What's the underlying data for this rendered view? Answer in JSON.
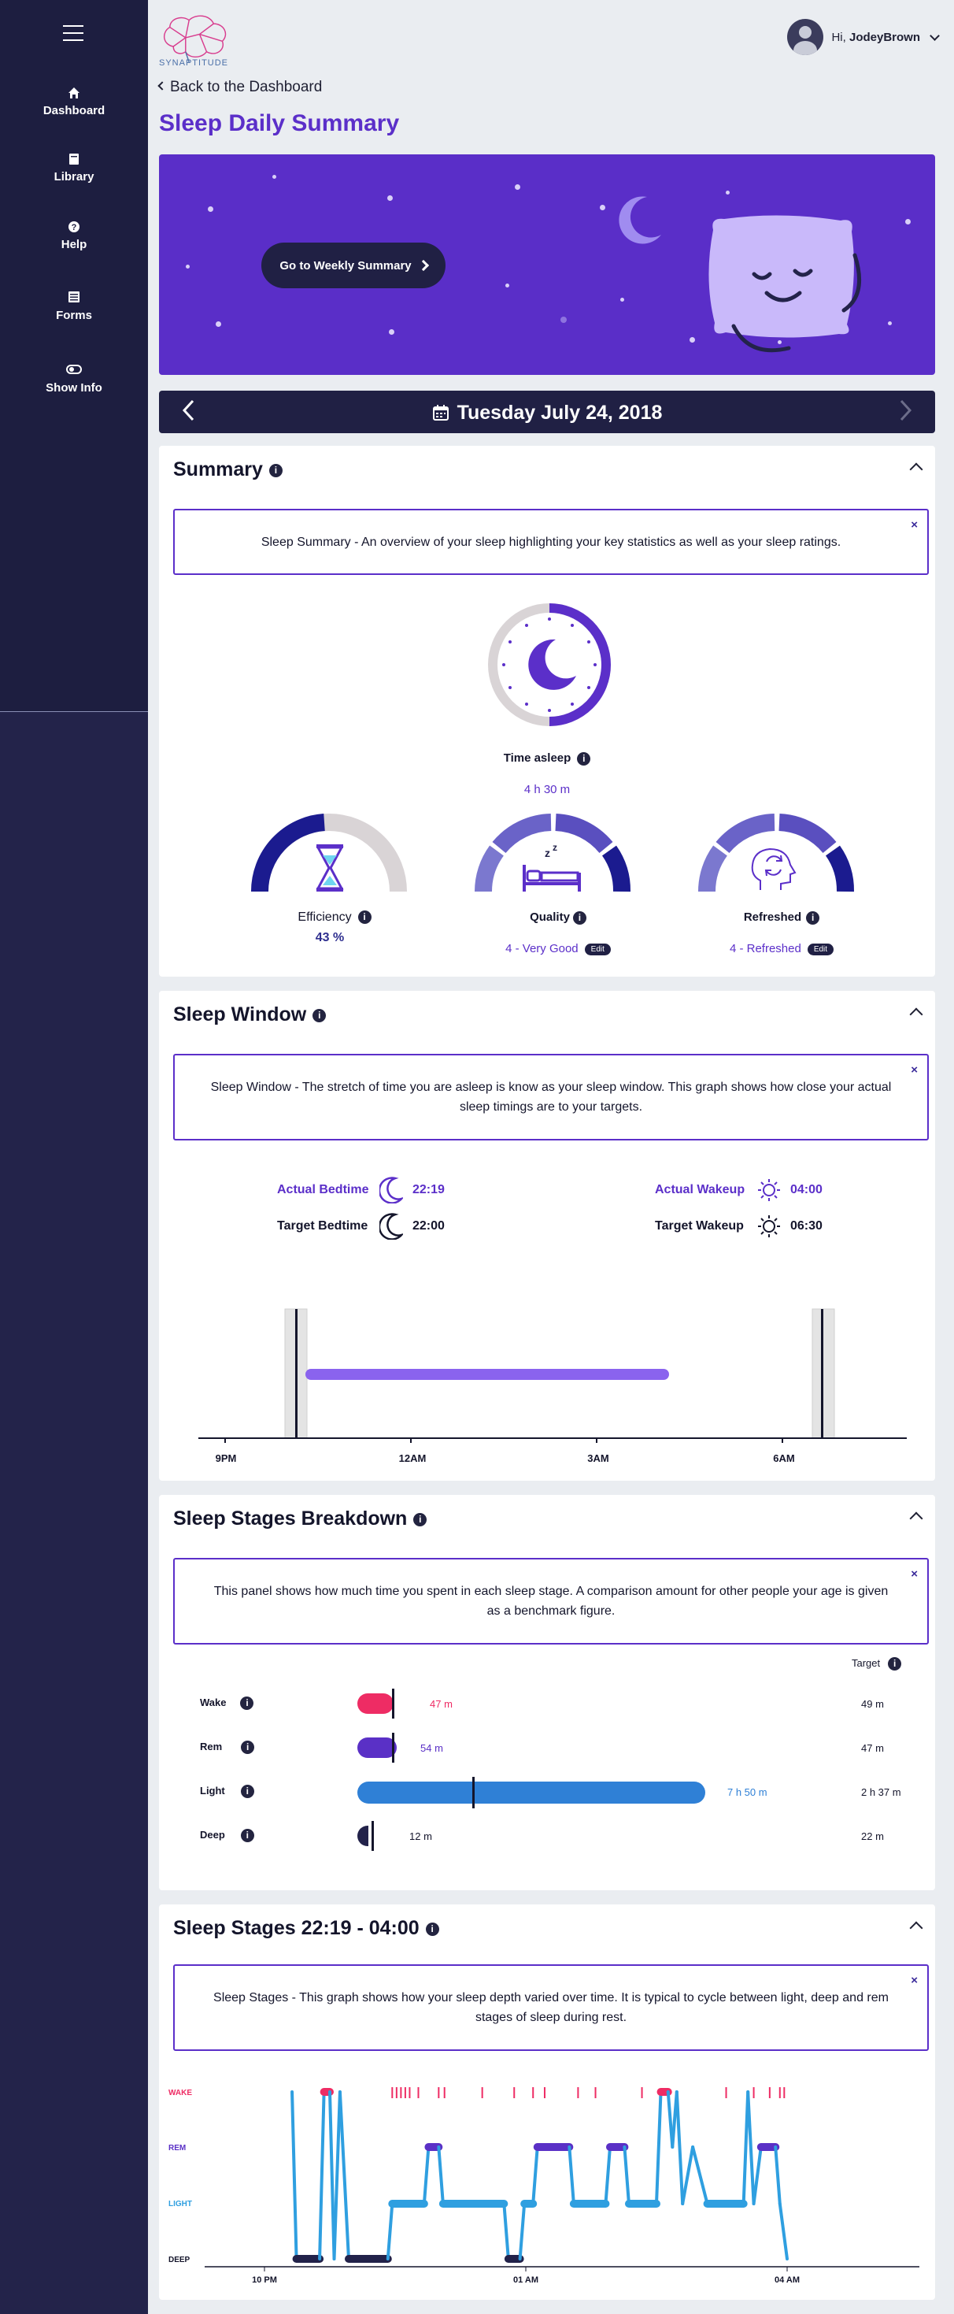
{
  "sidebar": {
    "items": [
      {
        "label": "Dashboard",
        "icon": "home-icon"
      },
      {
        "label": "Library",
        "icon": "book-icon"
      },
      {
        "label": "Help",
        "icon": "question-icon"
      },
      {
        "label": "Forms",
        "icon": "list-icon"
      },
      {
        "label": "Show Info",
        "icon": "toggle-icon"
      }
    ]
  },
  "header": {
    "logo_text": "SYNAPTITUDE",
    "greeting": "Hi,",
    "username": "JodeyBrown",
    "back_link": "Back to the Dashboard",
    "page_title": "Sleep Daily Summary"
  },
  "hero": {
    "button_label": "Go to Weekly Summary"
  },
  "datebar": {
    "date": "Tuesday July 24, 2018"
  },
  "summary": {
    "title": "Summary",
    "info": "Sleep Summary - An overview of your sleep highlighting your key statistics as well as your sleep ratings.",
    "time_asleep_label": "Time asleep",
    "time_asleep_value": "4 h 30 m",
    "efficiency_label": "Efficiency",
    "efficiency_value": "43 %",
    "quality_label": "Quality",
    "quality_value": "4 - Very Good",
    "refreshed_label": "Refreshed",
    "refreshed_value": "4 - Refreshed",
    "edit_label": "Edit",
    "colors": {
      "accent": "#5b2fc9",
      "dark": "#202044",
      "gauge_dark": "#1b1b8f",
      "gauge_light": "#7b78cf",
      "gauge_track": "#d9d4d6"
    }
  },
  "sleep_window": {
    "title": "Sleep Window",
    "info": "Sleep Window - The stretch of time you are asleep is know as your sleep window. This graph shows how close your actual sleep timings are to your targets.",
    "actual_bedtime_label": "Actual Bedtime",
    "actual_bedtime": "22:19",
    "target_bedtime_label": "Target Bedtime",
    "target_bedtime": "22:00",
    "actual_wakeup_label": "Actual Wakeup",
    "actual_wakeup": "04:00",
    "target_wakeup_label": "Target Wakeup",
    "target_wakeup": "06:30",
    "axis_ticks": [
      "9PM",
      "12AM",
      "3AM",
      "6AM"
    ]
  },
  "stages_breakdown": {
    "title": "Sleep Stages Breakdown",
    "info": "This panel shows how much time you spent in each sleep stage. A comparison amount for other people your age is given as a benchmark figure.",
    "target_header": "Target",
    "rows": [
      {
        "label": "Wake",
        "value": "47 m",
        "target": "49 m",
        "color": "#ee2c64"
      },
      {
        "label": "Rem",
        "value": "54 m",
        "target": "47 m",
        "color": "#5a30c6"
      },
      {
        "label": "Light",
        "value": "7 h 50 m",
        "target": "2 h 37 m",
        "color": "#2f80d6"
      },
      {
        "label": "Deep",
        "value": "12 m",
        "target": "22 m",
        "color": "#22224a"
      }
    ]
  },
  "stages_graph": {
    "title": "Sleep Stages 22:19 - 04:00",
    "info": "Sleep Stages - This graph shows how your sleep depth varied over time. It is typical to cycle between light, deep and rem stages of sleep during rest.",
    "y_labels": [
      "WAKE",
      "REM",
      "LIGHT",
      "DEEP"
    ],
    "x_labels": [
      "10 PM",
      "01 AM",
      "04 AM"
    ]
  },
  "chart_data": {
    "type": "line",
    "x_unit": "time",
    "y_categories": [
      "DEEP",
      "LIGHT",
      "REM",
      "WAKE"
    ],
    "points": [
      [
        "22:19",
        "WAKE"
      ],
      [
        "22:22",
        "DEEP"
      ],
      [
        "22:38",
        "DEEP"
      ],
      [
        "22:41",
        "WAKE"
      ],
      [
        "22:45",
        "WAKE"
      ],
      [
        "22:48",
        "DEEP"
      ],
      [
        "22:52",
        "WAKE"
      ],
      [
        "22:58",
        "DEEP"
      ],
      [
        "23:25",
        "DEEP"
      ],
      [
        "23:28",
        "LIGHT"
      ],
      [
        "23:50",
        "LIGHT"
      ],
      [
        "23:53",
        "REM"
      ],
      [
        "24:00",
        "REM"
      ],
      [
        "24:03",
        "LIGHT"
      ],
      [
        "00:45",
        "LIGHT"
      ],
      [
        "00:48",
        "DEEP"
      ],
      [
        "00:56",
        "DEEP"
      ],
      [
        "00:59",
        "LIGHT"
      ],
      [
        "01:05",
        "LIGHT"
      ],
      [
        "01:08",
        "REM"
      ],
      [
        "01:30",
        "REM"
      ],
      [
        "01:33",
        "LIGHT"
      ],
      [
        "01:55",
        "LIGHT"
      ],
      [
        "01:58",
        "REM"
      ],
      [
        "02:08",
        "REM"
      ],
      [
        "02:11",
        "LIGHT"
      ],
      [
        "02:30",
        "LIGHT"
      ],
      [
        "02:33",
        "WAKE"
      ],
      [
        "02:38",
        "WAKE"
      ],
      [
        "02:41",
        "REM"
      ],
      [
        "02:44",
        "WAKE"
      ],
      [
        "02:48",
        "LIGHT"
      ],
      [
        "02:55",
        "REM"
      ],
      [
        "03:05",
        "LIGHT"
      ],
      [
        "03:30",
        "LIGHT"
      ],
      [
        "03:33",
        "WAKE"
      ],
      [
        "03:37",
        "LIGHT"
      ],
      [
        "03:42",
        "REM"
      ],
      [
        "03:52",
        "REM"
      ],
      [
        "03:55",
        "LIGHT"
      ],
      [
        "04:00",
        "DEEP"
      ]
    ]
  }
}
